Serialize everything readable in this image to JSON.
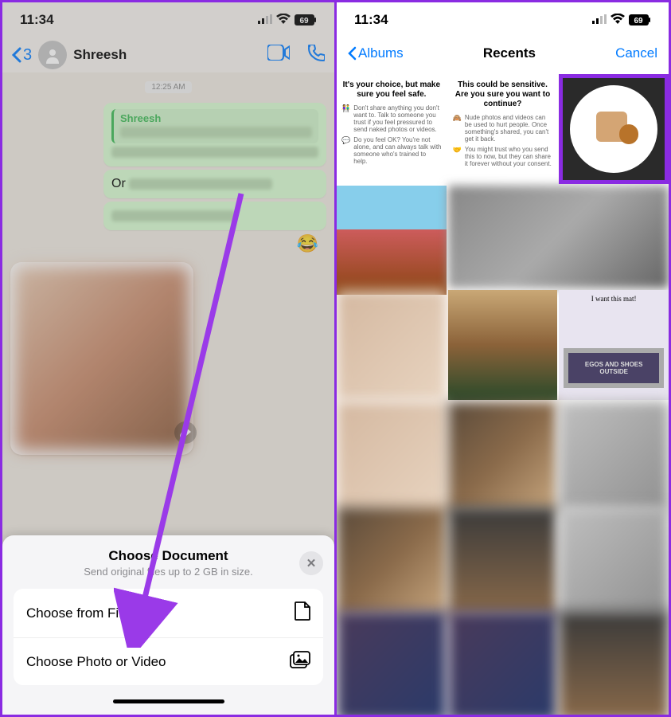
{
  "statusbar": {
    "time": "11:34",
    "battery": "69"
  },
  "left": {
    "header": {
      "back_count": "3",
      "contact_name": "Shreesh"
    },
    "chat": {
      "timestamp_pill": "12:25 AM",
      "reply_name": "Shreesh",
      "bubble3_prefix": "Or",
      "reaction_emoji": "😂"
    },
    "sheet": {
      "title": "Choose Document",
      "subtitle": "Send original files up to 2 GB in size.",
      "opt_files": "Choose from Files",
      "opt_media": "Choose Photo or Video"
    }
  },
  "right": {
    "picker": {
      "albums": "Albums",
      "title": "Recents",
      "cancel": "Cancel"
    },
    "info1": {
      "title": "It's your choice, but make sure you feel safe.",
      "line1": "Don't share anything you don't want to. Talk to someone you trust if you feel pressured to send naked photos or videos.",
      "line2": "Do you feel OK? You're not alone, and can always talk with someone who's trained to help."
    },
    "info2": {
      "title": "This could be sensitive. Are you sure you want to continue?",
      "line1": "Nude photos and videos can be used to hurt people. Once something's shared, you can't get it back.",
      "line2": "You might trust who you send this to now, but they can share it forever without your consent."
    },
    "mat": {
      "caption": "I want this mat!",
      "text": "EGOS AND SHOES OUTSIDE"
    }
  }
}
